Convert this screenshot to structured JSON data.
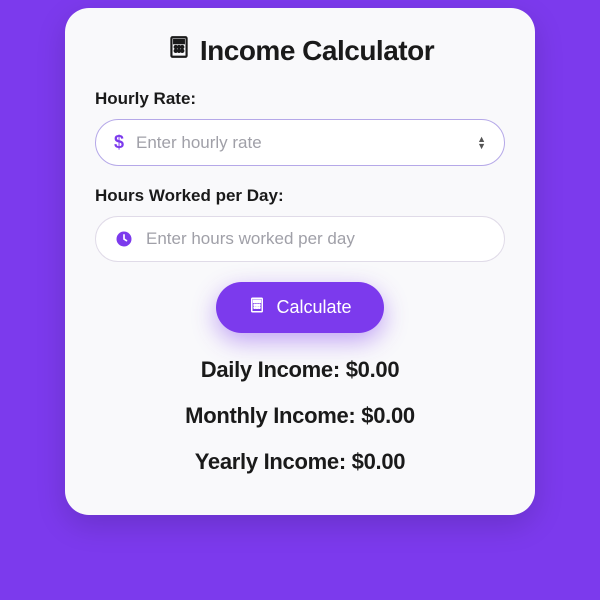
{
  "title": "Income Calculator",
  "form": {
    "rate_label": "Hourly Rate:",
    "rate_placeholder": "Enter hourly rate",
    "hours_label": "Hours Worked per Day:",
    "hours_placeholder": "Enter hours worked per day"
  },
  "button": {
    "label": "Calculate"
  },
  "results": {
    "daily_label": "Daily Income:",
    "daily_value": "$0.00",
    "monthly_label": "Monthly Income:",
    "monthly_value": "$0.00",
    "yearly_label": "Yearly Income:",
    "yearly_value": "$0.00"
  },
  "colors": {
    "accent": "#7c3aed"
  }
}
